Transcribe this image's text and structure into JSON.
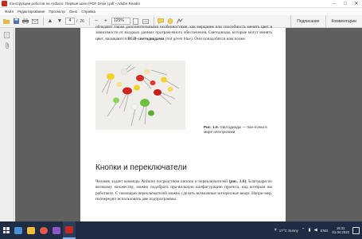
{
  "window": {
    "title": "Конструкции роботов на Arduino. Первые шаги (PDF Drive ).pdf - Adobe Reader"
  },
  "menu": [
    "Файл",
    "Редактирование",
    "Просмотр",
    "Окно",
    "Справка"
  ],
  "toolbar": {
    "page_current": "4",
    "page_separator": "/",
    "page_total": "26",
    "zoom": "125%",
    "sign_label": "Подписание",
    "comment_label": "Комментарии"
  },
  "document": {
    "para1": "обладают также дополнительными особенностями, как мерцание или способность менять цвет в зависимости от входных данных програм-много обеспечения. Светодиоды, которые могут менять цвет, называются",
    "para1_bold": "RGB-светодиодами",
    "para1_italic": "(red green blue)",
    "para1_end": ". Они понадобятся нам позже.",
    "caption_label": "Рис. 1.5.",
    "caption_text": "Светодиоды — пан-почки в мире электроники",
    "section_title": "Кнопки и переключатели",
    "para2_start": "Человек задает команды Arduino посредством кнопок и переключателей",
    "para2_ref": "(рис. 1.6)",
    "para2_end": ". Благодаря их великому множеству, можно подобрать пра-вильную конфигурацию проекта, над которым вы работаете. С помощью переключателей можно сделать возможные интересные вещи. Напри-мер, поочередно использовать две подпрограммы."
  },
  "taskbar": {
    "weather": "17°C Sunny",
    "language": "ENG",
    "time": "16:31",
    "date": "01.04.2022"
  },
  "colors": {
    "taskbar": "#1e2d44",
    "page_background": "#5f5f5f",
    "accent": "#c8281e"
  }
}
